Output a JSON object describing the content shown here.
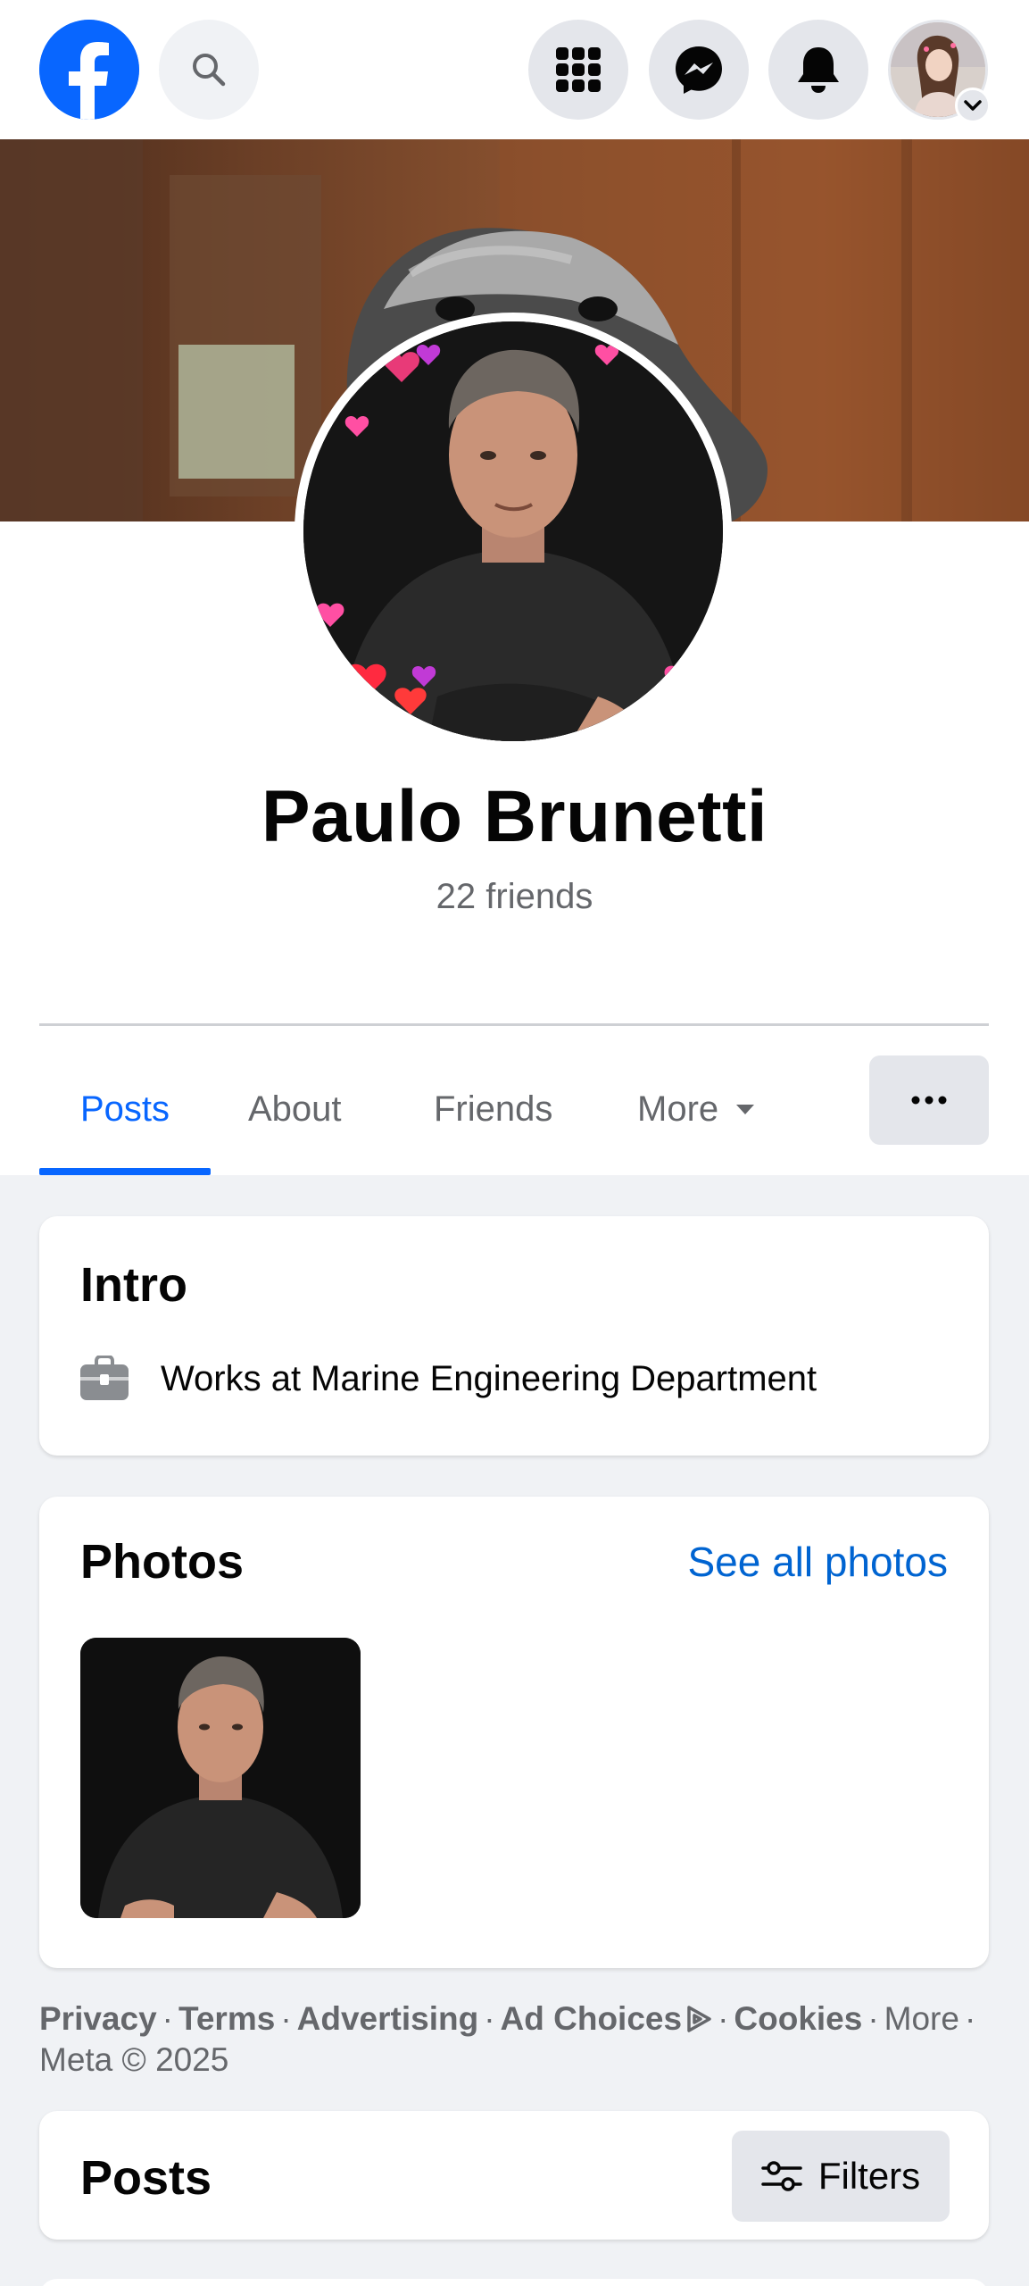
{
  "topbar": {
    "icons": [
      "facebook-logo",
      "search-icon",
      "menu-grid-icon",
      "messenger-icon",
      "bell-icon",
      "account-avatar",
      "chevron-down-icon"
    ]
  },
  "profile": {
    "name": "Paulo Brunetti",
    "friends": "22 friends"
  },
  "tabs": {
    "posts": "Posts",
    "about": "About",
    "friends": "Friends",
    "more": "More"
  },
  "intro": {
    "title": "Intro",
    "work": "Works at Marine Engineering Department"
  },
  "photos": {
    "title": "Photos",
    "see_all": "See all photos"
  },
  "footer": {
    "privacy": "Privacy",
    "terms": "Terms",
    "advertising": "Advertising",
    "ad_choices": "Ad Choices",
    "cookies": "Cookies",
    "more": "More",
    "copyright": "Meta © 2025",
    "separator": "·"
  },
  "posts_section": {
    "title": "Posts",
    "filters": "Filters"
  },
  "colors": {
    "accent": "#0866ff",
    "link": "#0064d1",
    "secondary_text": "#65676b",
    "page_bg": "#f0f2f5"
  }
}
